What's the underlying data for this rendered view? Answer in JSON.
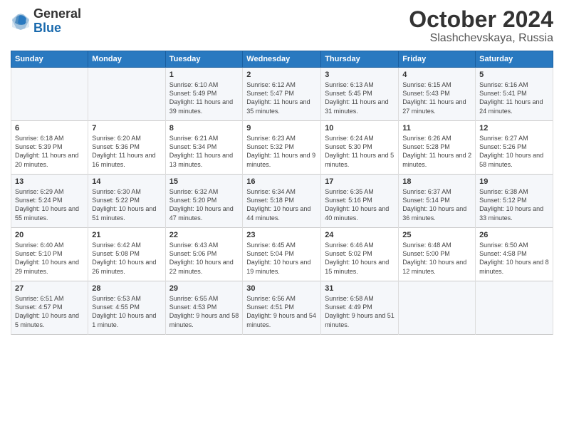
{
  "logo": {
    "general": "General",
    "blue": "Blue"
  },
  "title": {
    "month": "October 2024",
    "location": "Slashchevskaya, Russia"
  },
  "headers": [
    "Sunday",
    "Monday",
    "Tuesday",
    "Wednesday",
    "Thursday",
    "Friday",
    "Saturday"
  ],
  "weeks": [
    [
      {
        "day": "",
        "text": ""
      },
      {
        "day": "",
        "text": ""
      },
      {
        "day": "1",
        "text": "Sunrise: 6:10 AM\nSunset: 5:49 PM\nDaylight: 11 hours and 39 minutes."
      },
      {
        "day": "2",
        "text": "Sunrise: 6:12 AM\nSunset: 5:47 PM\nDaylight: 11 hours and 35 minutes."
      },
      {
        "day": "3",
        "text": "Sunrise: 6:13 AM\nSunset: 5:45 PM\nDaylight: 11 hours and 31 minutes."
      },
      {
        "day": "4",
        "text": "Sunrise: 6:15 AM\nSunset: 5:43 PM\nDaylight: 11 hours and 27 minutes."
      },
      {
        "day": "5",
        "text": "Sunrise: 6:16 AM\nSunset: 5:41 PM\nDaylight: 11 hours and 24 minutes."
      }
    ],
    [
      {
        "day": "6",
        "text": "Sunrise: 6:18 AM\nSunset: 5:39 PM\nDaylight: 11 hours and 20 minutes."
      },
      {
        "day": "7",
        "text": "Sunrise: 6:20 AM\nSunset: 5:36 PM\nDaylight: 11 hours and 16 minutes."
      },
      {
        "day": "8",
        "text": "Sunrise: 6:21 AM\nSunset: 5:34 PM\nDaylight: 11 hours and 13 minutes."
      },
      {
        "day": "9",
        "text": "Sunrise: 6:23 AM\nSunset: 5:32 PM\nDaylight: 11 hours and 9 minutes."
      },
      {
        "day": "10",
        "text": "Sunrise: 6:24 AM\nSunset: 5:30 PM\nDaylight: 11 hours and 5 minutes."
      },
      {
        "day": "11",
        "text": "Sunrise: 6:26 AM\nSunset: 5:28 PM\nDaylight: 11 hours and 2 minutes."
      },
      {
        "day": "12",
        "text": "Sunrise: 6:27 AM\nSunset: 5:26 PM\nDaylight: 10 hours and 58 minutes."
      }
    ],
    [
      {
        "day": "13",
        "text": "Sunrise: 6:29 AM\nSunset: 5:24 PM\nDaylight: 10 hours and 55 minutes."
      },
      {
        "day": "14",
        "text": "Sunrise: 6:30 AM\nSunset: 5:22 PM\nDaylight: 10 hours and 51 minutes."
      },
      {
        "day": "15",
        "text": "Sunrise: 6:32 AM\nSunset: 5:20 PM\nDaylight: 10 hours and 47 minutes."
      },
      {
        "day": "16",
        "text": "Sunrise: 6:34 AM\nSunset: 5:18 PM\nDaylight: 10 hours and 44 minutes."
      },
      {
        "day": "17",
        "text": "Sunrise: 6:35 AM\nSunset: 5:16 PM\nDaylight: 10 hours and 40 minutes."
      },
      {
        "day": "18",
        "text": "Sunrise: 6:37 AM\nSunset: 5:14 PM\nDaylight: 10 hours and 36 minutes."
      },
      {
        "day": "19",
        "text": "Sunrise: 6:38 AM\nSunset: 5:12 PM\nDaylight: 10 hours and 33 minutes."
      }
    ],
    [
      {
        "day": "20",
        "text": "Sunrise: 6:40 AM\nSunset: 5:10 PM\nDaylight: 10 hours and 29 minutes."
      },
      {
        "day": "21",
        "text": "Sunrise: 6:42 AM\nSunset: 5:08 PM\nDaylight: 10 hours and 26 minutes."
      },
      {
        "day": "22",
        "text": "Sunrise: 6:43 AM\nSunset: 5:06 PM\nDaylight: 10 hours and 22 minutes."
      },
      {
        "day": "23",
        "text": "Sunrise: 6:45 AM\nSunset: 5:04 PM\nDaylight: 10 hours and 19 minutes."
      },
      {
        "day": "24",
        "text": "Sunrise: 6:46 AM\nSunset: 5:02 PM\nDaylight: 10 hours and 15 minutes."
      },
      {
        "day": "25",
        "text": "Sunrise: 6:48 AM\nSunset: 5:00 PM\nDaylight: 10 hours and 12 minutes."
      },
      {
        "day": "26",
        "text": "Sunrise: 6:50 AM\nSunset: 4:58 PM\nDaylight: 10 hours and 8 minutes."
      }
    ],
    [
      {
        "day": "27",
        "text": "Sunrise: 6:51 AM\nSunset: 4:57 PM\nDaylight: 10 hours and 5 minutes."
      },
      {
        "day": "28",
        "text": "Sunrise: 6:53 AM\nSunset: 4:55 PM\nDaylight: 10 hours and 1 minute."
      },
      {
        "day": "29",
        "text": "Sunrise: 6:55 AM\nSunset: 4:53 PM\nDaylight: 9 hours and 58 minutes."
      },
      {
        "day": "30",
        "text": "Sunrise: 6:56 AM\nSunset: 4:51 PM\nDaylight: 9 hours and 54 minutes."
      },
      {
        "day": "31",
        "text": "Sunrise: 6:58 AM\nSunset: 4:49 PM\nDaylight: 9 hours and 51 minutes."
      },
      {
        "day": "",
        "text": ""
      },
      {
        "day": "",
        "text": ""
      }
    ]
  ]
}
